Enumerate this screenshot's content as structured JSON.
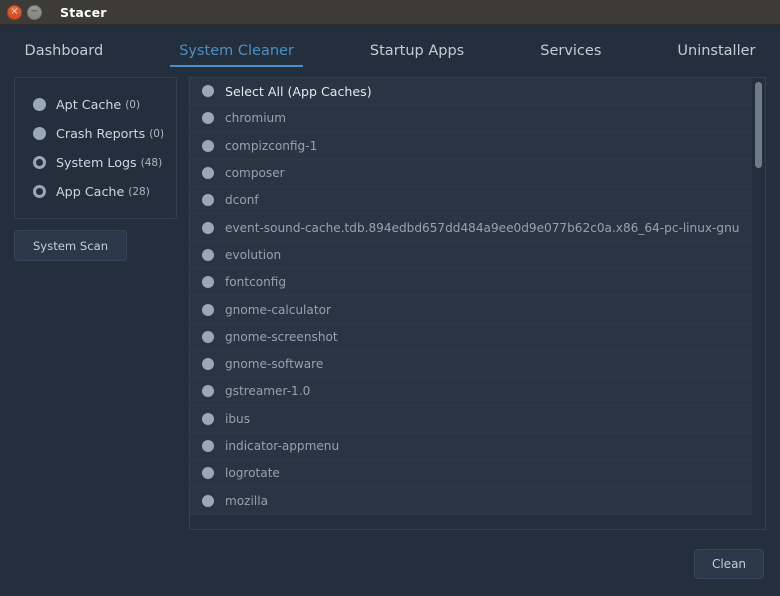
{
  "window": {
    "title": "Stacer",
    "close_icon": "close-icon",
    "close_glyph": "×",
    "minimize_icon": "minimize-icon",
    "minimize_glyph": "−"
  },
  "colors": {
    "accent": "#4a90c4",
    "titlebar": "#3c3b37",
    "background": "#242f3d",
    "row": "#2a3544",
    "close_button": "#d8532a",
    "minimize_button": "#8d8d87"
  },
  "tabs": [
    {
      "label": "Dashboard",
      "active": false
    },
    {
      "label": "System Cleaner",
      "active": true
    },
    {
      "label": "Startup Apps",
      "active": false
    },
    {
      "label": "Services",
      "active": false
    },
    {
      "label": "Uninstaller",
      "active": false
    }
  ],
  "sidebar": {
    "items": [
      {
        "label": "Apt Cache",
        "count": "(0)",
        "checked": false
      },
      {
        "label": "Crash Reports",
        "count": "(0)",
        "checked": false
      },
      {
        "label": "System Logs",
        "count": "(48)",
        "checked": true
      },
      {
        "label": "App Cache",
        "count": "(28)",
        "checked": true
      }
    ],
    "scan_button": "System Scan"
  },
  "list": {
    "select_all": "Select All (App Caches)",
    "items": [
      "chromium",
      "compizconfig-1",
      "composer",
      "dconf",
      "event-sound-cache.tdb.894edbd657dd484a9ee0d9e077b62c0a.x86_64-pc-linux-gnu",
      "evolution",
      "fontconfig",
      "gnome-calculator",
      "gnome-screenshot",
      "gnome-software",
      "gstreamer-1.0",
      "ibus",
      "indicator-appmenu",
      "logrotate",
      "mozilla"
    ]
  },
  "footer": {
    "clean_button": "Clean"
  }
}
